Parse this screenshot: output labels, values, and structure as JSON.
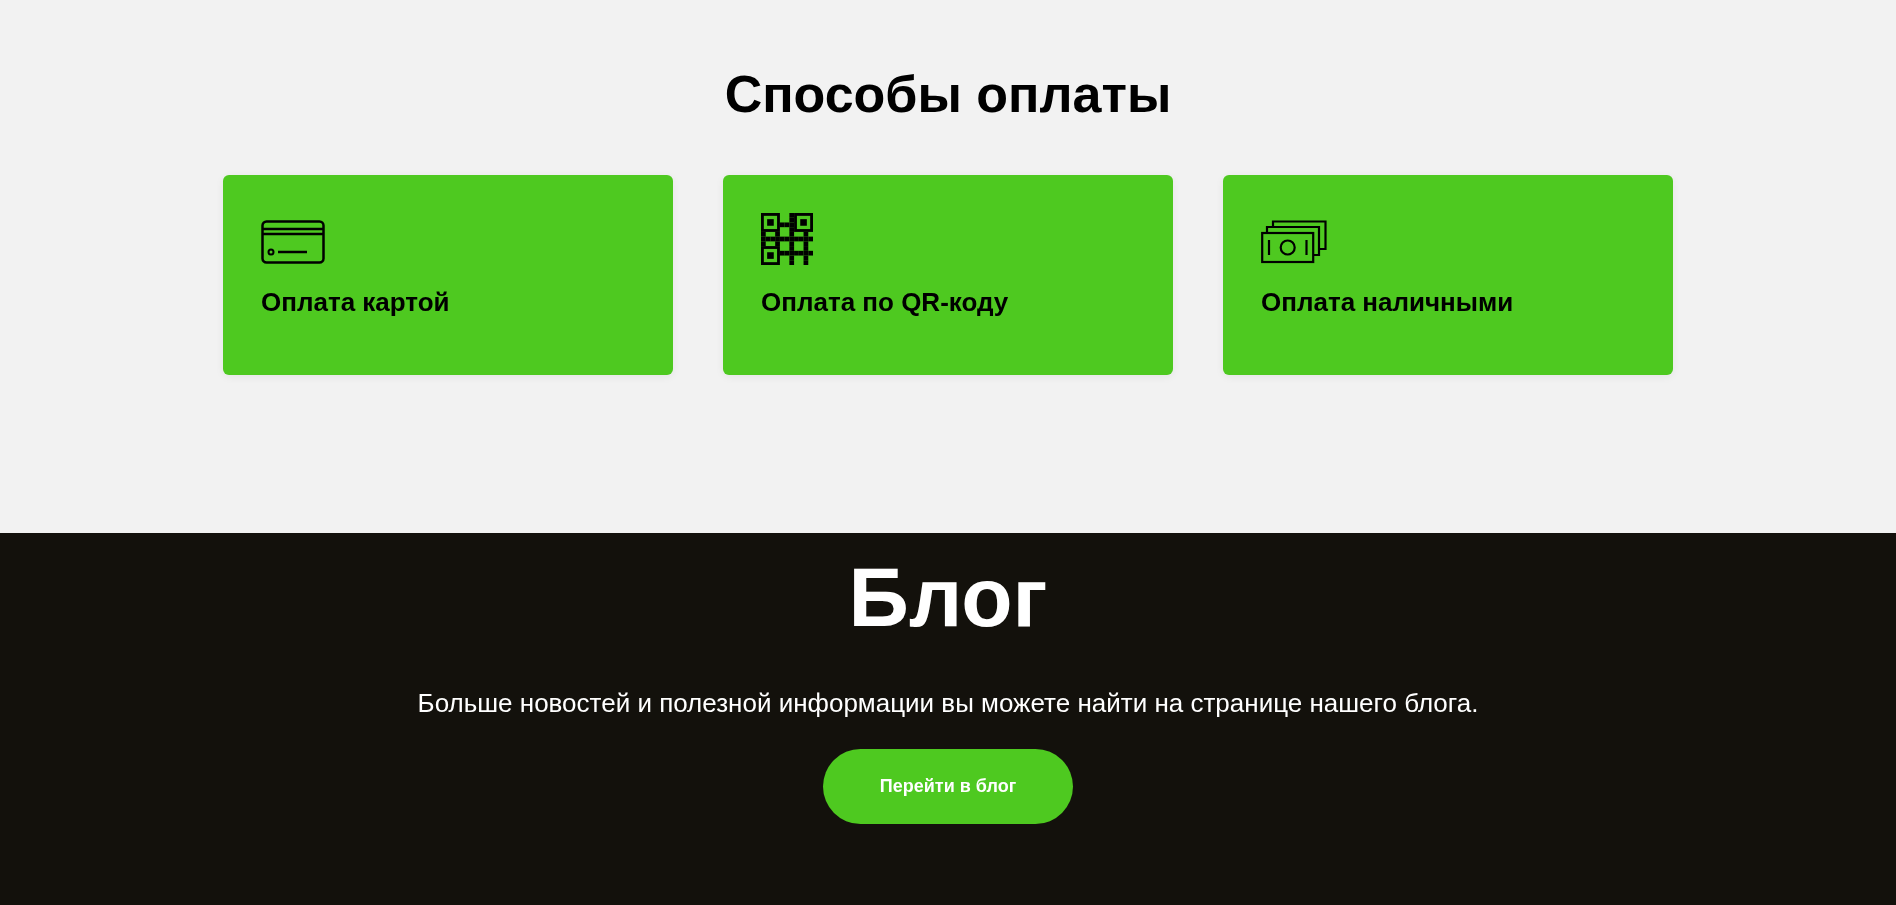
{
  "payment": {
    "title": "Способы оплаты",
    "methods": [
      {
        "kind": "card",
        "label": "Оплата картой"
      },
      {
        "kind": "qr",
        "label": "Оплата по QR-коду"
      },
      {
        "kind": "cash",
        "label": "Оплата наличными"
      }
    ]
  },
  "blog": {
    "title": "Блог",
    "text": "Больше новостей и полезной информации вы можете найти на странице нашего блога.",
    "button": "Перейти в блог"
  }
}
